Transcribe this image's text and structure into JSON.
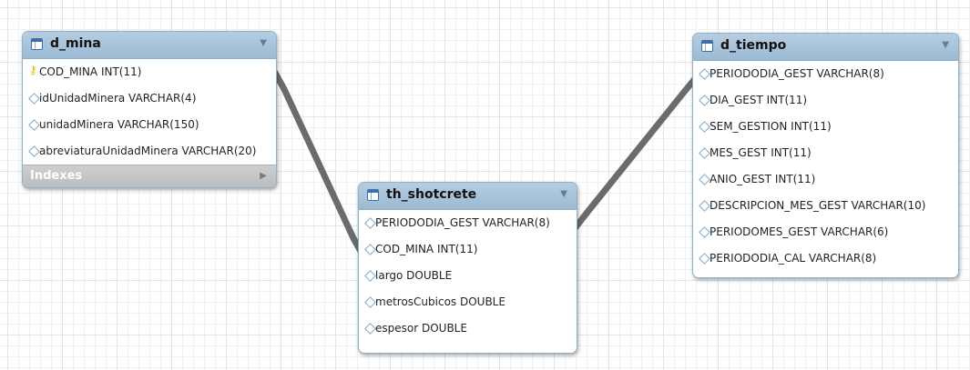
{
  "colors": {
    "header_gradient_top": "#b6cde1",
    "header_gradient_bottom": "#9bbad3",
    "table_border": "#8fb0c9",
    "relationship_line": "#6b6b6b",
    "indexes_bar": "#c4c4c4"
  },
  "icons": {
    "table": "table-icon",
    "primary_key": "key-icon",
    "column": "diamond-icon",
    "collapse": "triangle-down-icon",
    "expand": "triangle-right-icon"
  },
  "tables": {
    "d_mina": {
      "name": "d_mina",
      "columns": [
        {
          "text": "COD_MINA INT(11)",
          "pk": true
        },
        {
          "text": "idUnidadMinera VARCHAR(4)",
          "pk": false
        },
        {
          "text": "unidadMinera VARCHAR(150)",
          "pk": false
        },
        {
          "text": "abreviaturaUnidadMinera VARCHAR(20)",
          "pk": false
        }
      ],
      "indexes_label": "Indexes"
    },
    "th_shotcrete": {
      "name": "th_shotcrete",
      "columns": [
        {
          "text": "PERIODODIA_GEST VARCHAR(8)",
          "pk": false
        },
        {
          "text": "COD_MINA INT(11)",
          "pk": false
        },
        {
          "text": "largo DOUBLE",
          "pk": false
        },
        {
          "text": "metrosCubicos DOUBLE",
          "pk": false
        },
        {
          "text": "espesor DOUBLE",
          "pk": false
        }
      ]
    },
    "d_tiempo": {
      "name": "d_tiempo",
      "columns": [
        {
          "text": "PERIODODIA_GEST VARCHAR(8)",
          "pk": false
        },
        {
          "text": "DIA_GEST INT(11)",
          "pk": false
        },
        {
          "text": "SEM_GESTION INT(11)",
          "pk": false
        },
        {
          "text": "MES_GEST INT(11)",
          "pk": false
        },
        {
          "text": "ANIO_GEST INT(11)",
          "pk": false
        },
        {
          "text": "DESCRIPCION_MES_GEST VARCHAR(10)",
          "pk": false
        },
        {
          "text": "PERIODOMES_GEST VARCHAR(6)",
          "pk": false
        },
        {
          "text": "PERIODODIA_CAL VARCHAR(8)",
          "pk": false
        }
      ]
    }
  },
  "relationships": [
    {
      "from": "d_mina.COD_MINA",
      "to": "th_shotcrete.COD_MINA"
    },
    {
      "from": "d_tiempo.PERIODODIA_GEST",
      "to": "th_shotcrete.PERIODODIA_GEST"
    }
  ]
}
